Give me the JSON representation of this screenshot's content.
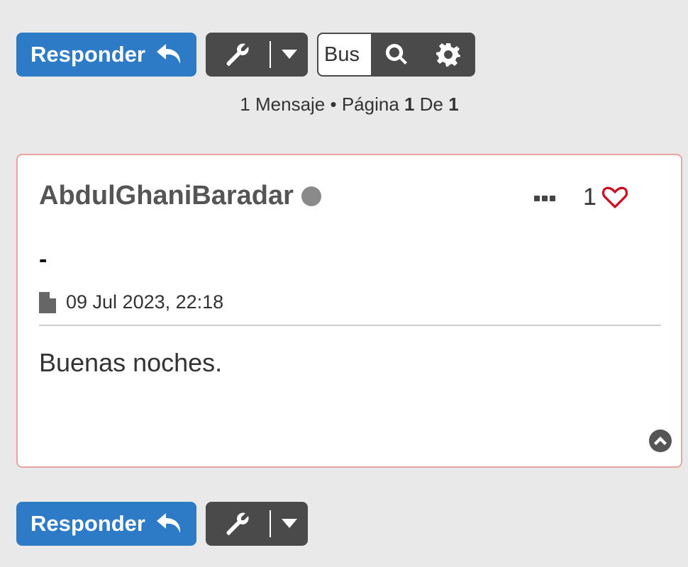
{
  "toolbar": {
    "reply_label": "Responder",
    "search_placeholder": "Bus"
  },
  "pagination": {
    "count": "1",
    "messages_label": "Mensaje",
    "separator": "•",
    "page_label": "Página",
    "current_page": "1",
    "of_label": "De",
    "total_pages": "1"
  },
  "post": {
    "author": "AbdulGhaniBaradar",
    "like_count": "1",
    "title": "-",
    "date": "09 Jul 2023, 22:18",
    "content": "Buenas noches."
  },
  "colors": {
    "primary_button": "#2d7bc7",
    "dark_button": "#4a4a4a",
    "post_border": "#e9a3a3",
    "heart": "#d0021b",
    "offline_status": "#8a8a8a"
  },
  "icons": [
    "reply-icon",
    "wrench-icon",
    "caret-down-icon",
    "search-icon",
    "gear-icon",
    "more-icon",
    "heart-icon",
    "file-icon",
    "chevron-up-icon"
  ]
}
